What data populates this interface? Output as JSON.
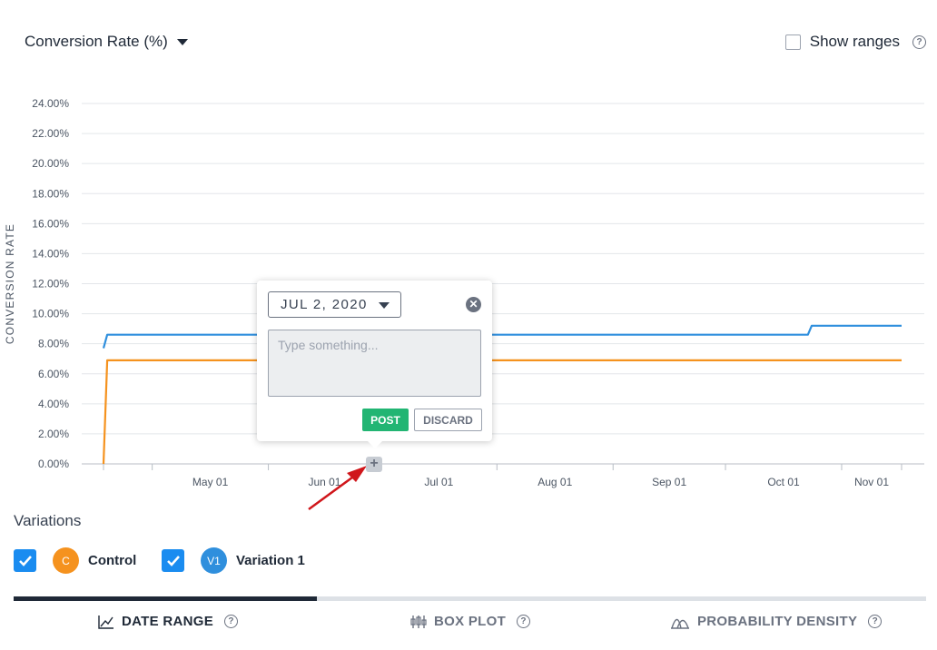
{
  "header": {
    "metric_label": "Conversion Rate (%)",
    "show_ranges_label": "Show ranges"
  },
  "chart_data": {
    "type": "line",
    "ylabel": "CONVERSION RATE",
    "xlabel": "",
    "ylim": [
      0,
      24
    ],
    "y_ticks": [
      "0.00%",
      "2.00%",
      "4.00%",
      "6.00%",
      "8.00%",
      "10.00%",
      "12.00%",
      "14.00%",
      "16.00%",
      "18.00%",
      "20.00%",
      "22.00%",
      "24.00%"
    ],
    "x_ticks": [
      "May 01",
      "Jun 01",
      "Jul 01",
      "Aug 01",
      "Sep 01",
      "Oct 01",
      "Nov 01"
    ],
    "x_range": [
      "2020-04-18",
      "2020-11-17"
    ],
    "grid": true,
    "series": [
      {
        "name": "Variation 1",
        "color": "#2f8fdd",
        "points": [
          [
            "2020-04-18",
            7.7
          ],
          [
            "2020-04-19",
            8.6
          ],
          [
            "2020-10-23",
            8.6
          ],
          [
            "2020-10-24",
            9.2
          ],
          [
            "2020-11-17",
            9.2
          ]
        ]
      },
      {
        "name": "Control",
        "color": "#f5921e",
        "points": [
          [
            "2020-04-18",
            0.0
          ],
          [
            "2020-04-19",
            6.9
          ],
          [
            "2020-11-17",
            6.9
          ]
        ]
      }
    ]
  },
  "annotation_popup": {
    "date_value": "JUL 2, 2020",
    "placeholder": "Type something...",
    "post_label": "POST",
    "discard_label": "DISCARD"
  },
  "variations": {
    "title": "Variations",
    "items": [
      {
        "badge": "C",
        "name": "Control",
        "color": "#f5921e"
      },
      {
        "badge": "V1",
        "name": "Variation 1",
        "color": "#2f8fdd"
      }
    ]
  },
  "tabs": [
    {
      "label": "DATE RANGE",
      "icon": "line-chart-icon",
      "active": true,
      "color": "#1f2937"
    },
    {
      "label": "BOX PLOT",
      "icon": "box-plot-icon",
      "active": false,
      "color": "#6b7280"
    },
    {
      "label": "PROBABILITY DENSITY",
      "icon": "density-icon",
      "active": false,
      "color": "#6b7280"
    }
  ]
}
